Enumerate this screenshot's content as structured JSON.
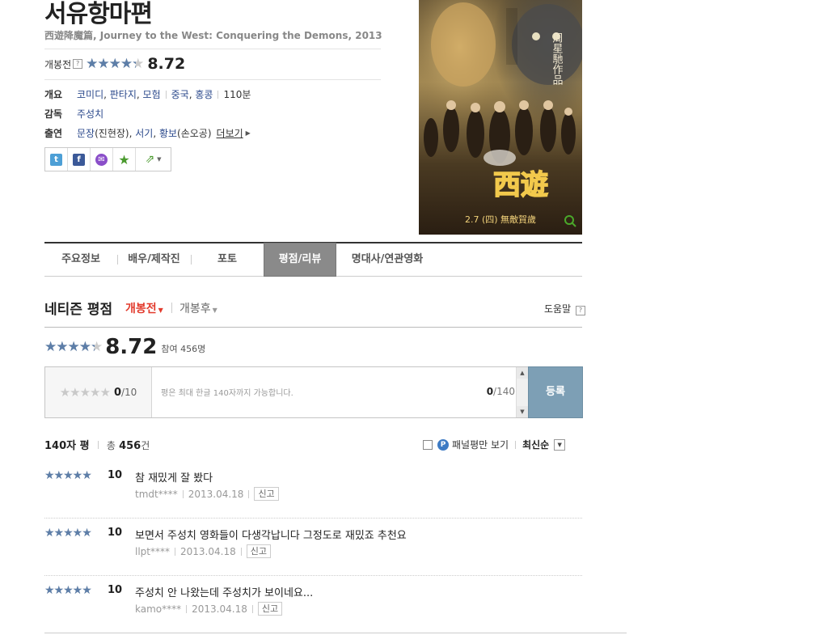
{
  "movie": {
    "title": "서유항마편",
    "subtitle": "西遊降魔篇, Journey to the West: Conquering the Demons, 2013",
    "rating_label": "개봉전",
    "rating_value": "8.72",
    "rating_fraction": 0.872
  },
  "info": {
    "genre_label": "개요",
    "genres": [
      "코미디",
      "판타지",
      "모험"
    ],
    "countries": [
      "중국",
      "홍콩"
    ],
    "runtime": "110분",
    "director_label": "감독",
    "director": "주성치",
    "cast_label": "출연",
    "cast": [
      {
        "name": "문장",
        "role": "(진현장)"
      },
      {
        "name": "서기",
        "role": ""
      },
      {
        "name": "황보",
        "role": "(손오공)"
      }
    ],
    "more": "더보기"
  },
  "share": {
    "icons": [
      "twitter-icon",
      "facebook-icon",
      "kakao-icon",
      "favorite-star-icon",
      "share-icon"
    ],
    "colors": {
      "twitter": "#4d9fd6",
      "facebook": "#3b5998",
      "kakao": "#8a4ec9",
      "star": "#4a9a2e",
      "share": "#4a9a2e"
    }
  },
  "tabs": [
    {
      "label": "주요정보",
      "active": false
    },
    {
      "label": "배우/제작진",
      "active": false
    },
    {
      "label": "포토",
      "active": false
    },
    {
      "label": "평점/리뷰",
      "active": true
    },
    {
      "label": "명대사/연관영화",
      "active": false
    }
  ],
  "netizen": {
    "title": "네티즌 평점",
    "filter_before": "개봉전",
    "filter_after": "개봉후",
    "help": "도움말",
    "score": "8.72",
    "score_fraction": 0.872,
    "participants": "참여 456명"
  },
  "input": {
    "my_score": "0",
    "my_score_max": "/10",
    "placeholder": "평은 최대 한글 140자까지 가능합니다.",
    "char_count": "0",
    "char_max": "/140",
    "submit": "등록"
  },
  "list": {
    "title": "140자 평",
    "total_label": "총",
    "total": "456",
    "total_unit": "건",
    "panel_only": "패널평만 보기",
    "sort": "최신순"
  },
  "reviews": [
    {
      "score": "10",
      "fraction": 1.0,
      "text": "참 재밌게 잘 봤다",
      "user": "tmdt****",
      "date": "2013.04.18",
      "report": "신고"
    },
    {
      "score": "10",
      "fraction": 1.0,
      "text": "보면서 주성치 영화들이 다생각납니다 그정도로 재밌죠 추천요",
      "user": "llpt****",
      "date": "2013.04.18",
      "report": "신고"
    },
    {
      "score": "10",
      "fraction": 1.0,
      "text": "주성치 안 나왔는데 주성치가 보이네요...",
      "user": "kamo****",
      "date": "2013.04.18",
      "report": "신고"
    }
  ]
}
